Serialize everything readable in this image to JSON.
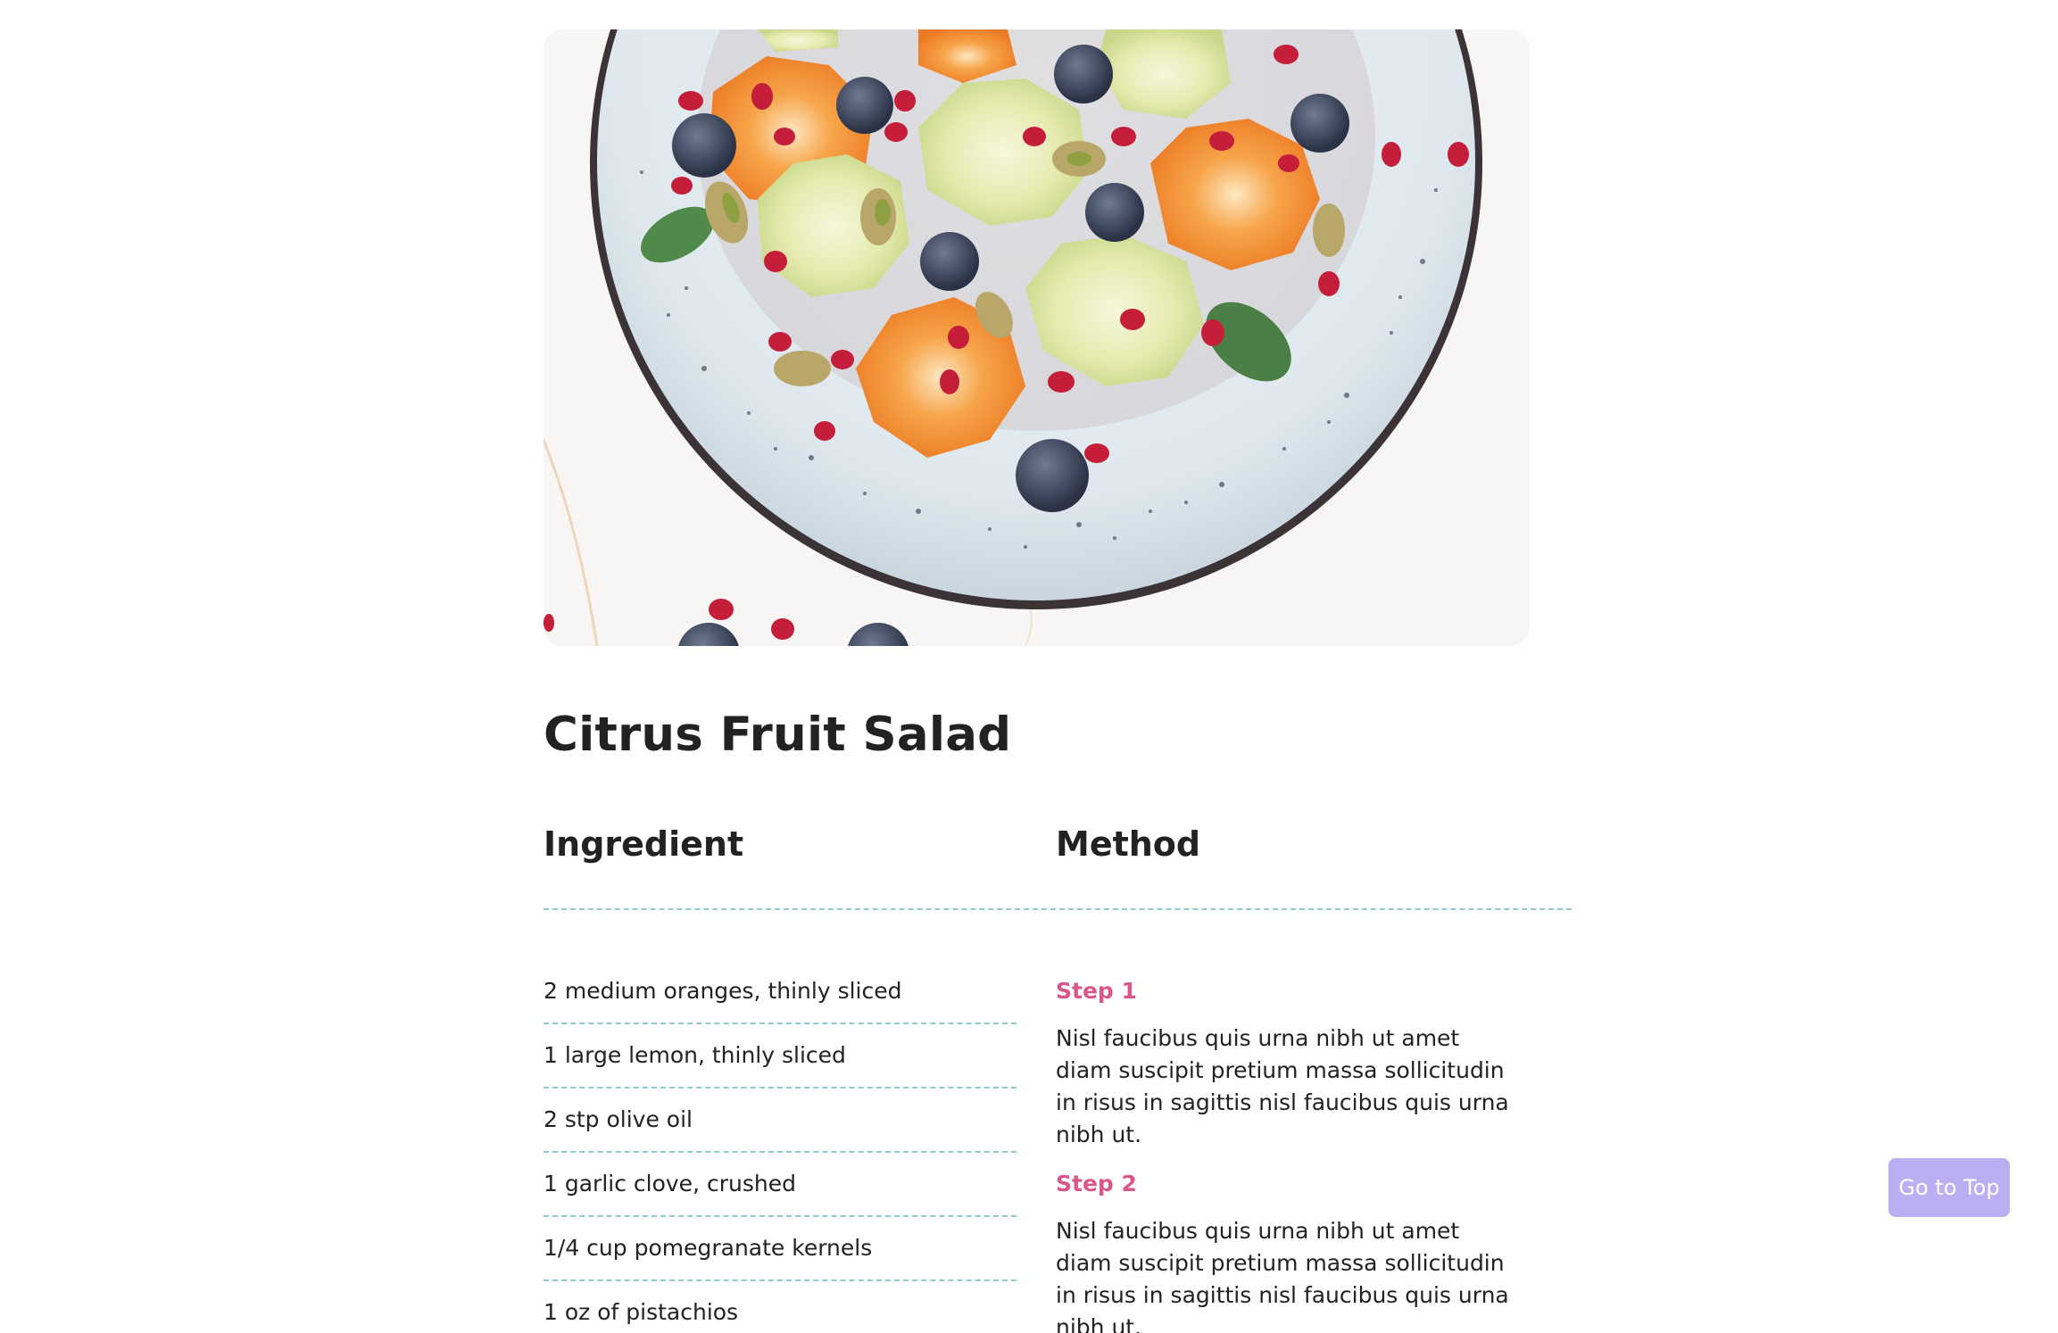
{
  "recipe": {
    "title": "Citrus Fruit Salad",
    "image_alt": "Citrus fruit salad on a speckled plate"
  },
  "ingredients": {
    "heading": "Ingredient",
    "items": [
      "2 medium oranges, thinly sliced",
      "1 large lemon, thinly sliced",
      "2 stp olive oil",
      "1 garlic clove, crushed",
      "1/4 cup pomegranate kernels",
      "1 oz of pistachios"
    ]
  },
  "method": {
    "heading": "Method",
    "steps": [
      {
        "title": "Step 1",
        "text": "Nisl faucibus quis urna nibh ut amet diam suscipit pretium massa sollicitudin in risus in sagittis nisl faucibus quis urna nibh ut."
      },
      {
        "title": "Step 2",
        "text": "Nisl faucibus quis urna nibh ut amet diam suscipit pretium massa sollicitudin in risus in sagittis nisl faucibus quis urna nibh ut."
      }
    ]
  },
  "go_top_button": {
    "label": "Go to Top",
    "color": "#b8b0f3"
  },
  "colors": {
    "accent_step": "#d9568b",
    "divider": "#8fcbcb",
    "text": "#222222"
  }
}
